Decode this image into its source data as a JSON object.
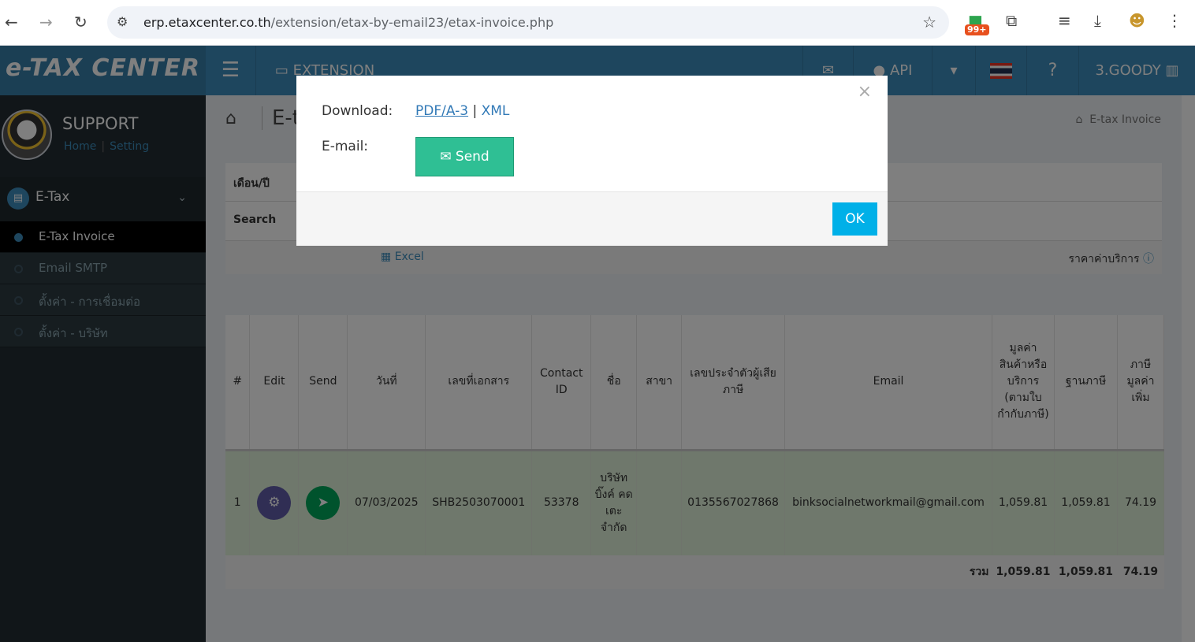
{
  "browser": {
    "url_domain": "erp.etaxcenter.co.th",
    "url_path": "/extension/etax-by-email23/etax-invoice.php",
    "ext_badge": "99+"
  },
  "sidebar": {
    "logo": "e-TAX CENTER",
    "user_name": "SUPPORT",
    "link_home": "Home",
    "link_setting": "Setting",
    "menu_head": "E-Tax",
    "items": [
      {
        "label": "E-Tax Invoice"
      },
      {
        "label": "Email SMTP"
      },
      {
        "label": "ตั้งค่า - การเชื่อมต่อ"
      },
      {
        "label": "ตั้งค่า - บริษัท"
      }
    ]
  },
  "navbar": {
    "extension": "EXTENSION",
    "api": "API",
    "company": "3.GOODY"
  },
  "content": {
    "title": "E-tax Invoice",
    "breadcrumb": "E-tax Invoice",
    "filter_month": "เดือน/ปี",
    "filter_search": "Search",
    "excel": "Excel",
    "price": "ราคาค่าบริการ"
  },
  "table": {
    "headers": [
      "#",
      "Edit",
      "Send",
      "วันที่",
      "เลขที่เอกสาร",
      "Contact ID",
      "ชื่อ",
      "สาขา",
      "เลขประจำตัวผู้เสียภาษี",
      "Email",
      "มูลค่าสินค้าหรือบริการ (ตามใบกำกับภาษี)",
      "ฐานภาษี",
      "ภาษีมูลค่าเพิ่ม"
    ],
    "row": {
      "no": "1",
      "date": "07/03/2025",
      "doc": "SHB2503070001",
      "contact": "53378",
      "name": "บริษัท บิ๊งค์ คด เตะ จำกัด",
      "branch": "",
      "taxid": "0135567027868",
      "email": "binksocialnetworkmail@gmail.com",
      "value": "1,059.81",
      "base": "1,059.81",
      "vat": "74.19"
    },
    "total": {
      "label": "รวม",
      "value": "1,059.81",
      "base": "1,059.81",
      "vat": "74.19"
    }
  },
  "modal": {
    "close": "×",
    "download_label": "Download:",
    "pdf": "PDF/A-3",
    "separator": "|",
    "xml": "XML",
    "email_label": "E-mail:",
    "send": "Send",
    "ok": "OK"
  },
  "colors": {
    "navbar": "#3c8dbc",
    "sidebar": "#222d32",
    "send_button": "#2fbf94",
    "ok_button": "#00b0e8",
    "edit_circle": "#605ca8",
    "send_circle": "#00a65a"
  }
}
